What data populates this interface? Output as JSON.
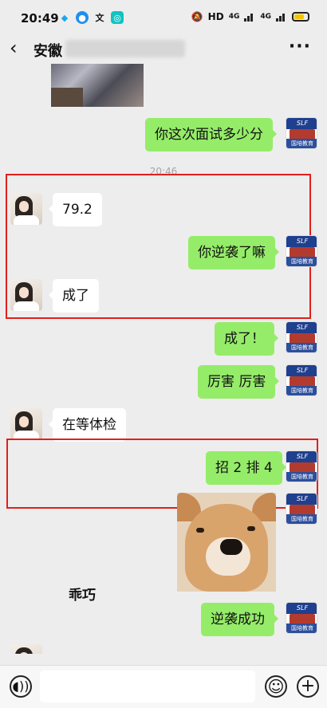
{
  "status_bar": {
    "time": "20:49",
    "network": "HD",
    "signal_1": "4G",
    "signal_2": "4G"
  },
  "header": {
    "title": "安徽",
    "back_icon": "chevron-left-icon",
    "more_icon": "more-dots-icon",
    "more_label": "···"
  },
  "messages": [
    {
      "side": "out",
      "text": "你这次面试多少分"
    },
    {
      "type": "timestamp",
      "text": "20:46"
    },
    {
      "side": "in",
      "text": "79.2"
    },
    {
      "side": "out",
      "text": "你逆袭了嘛"
    },
    {
      "side": "in",
      "text": "成了"
    },
    {
      "side": "out",
      "text": "成了！"
    },
    {
      "side": "out",
      "text": "厉害 厉害"
    },
    {
      "side": "in",
      "text": "在等体检"
    },
    {
      "side": "out",
      "text": "招 2 排 4"
    },
    {
      "side": "out",
      "type": "sticker",
      "icon": "shiba-dog-sticker"
    },
    {
      "side": "out",
      "text": "逆袭成功"
    },
    {
      "side": "in",
      "text": "乖巧"
    }
  ],
  "avatars": {
    "org_top": "SLF",
    "org_bottom": "国培教育"
  },
  "input_bar": {
    "voice_icon": "voice-icon",
    "emoji_icon": "emoji-icon",
    "plus_icon": "plus-icon",
    "voice_glyph": "◖))",
    "emoji_glyph": "☺",
    "plus_glyph": "+"
  },
  "colors": {
    "outgoing_bubble": "#95ec69",
    "incoming_bubble": "#ffffff",
    "chat_background": "#ededed",
    "highlight_box": "#e0201c"
  }
}
